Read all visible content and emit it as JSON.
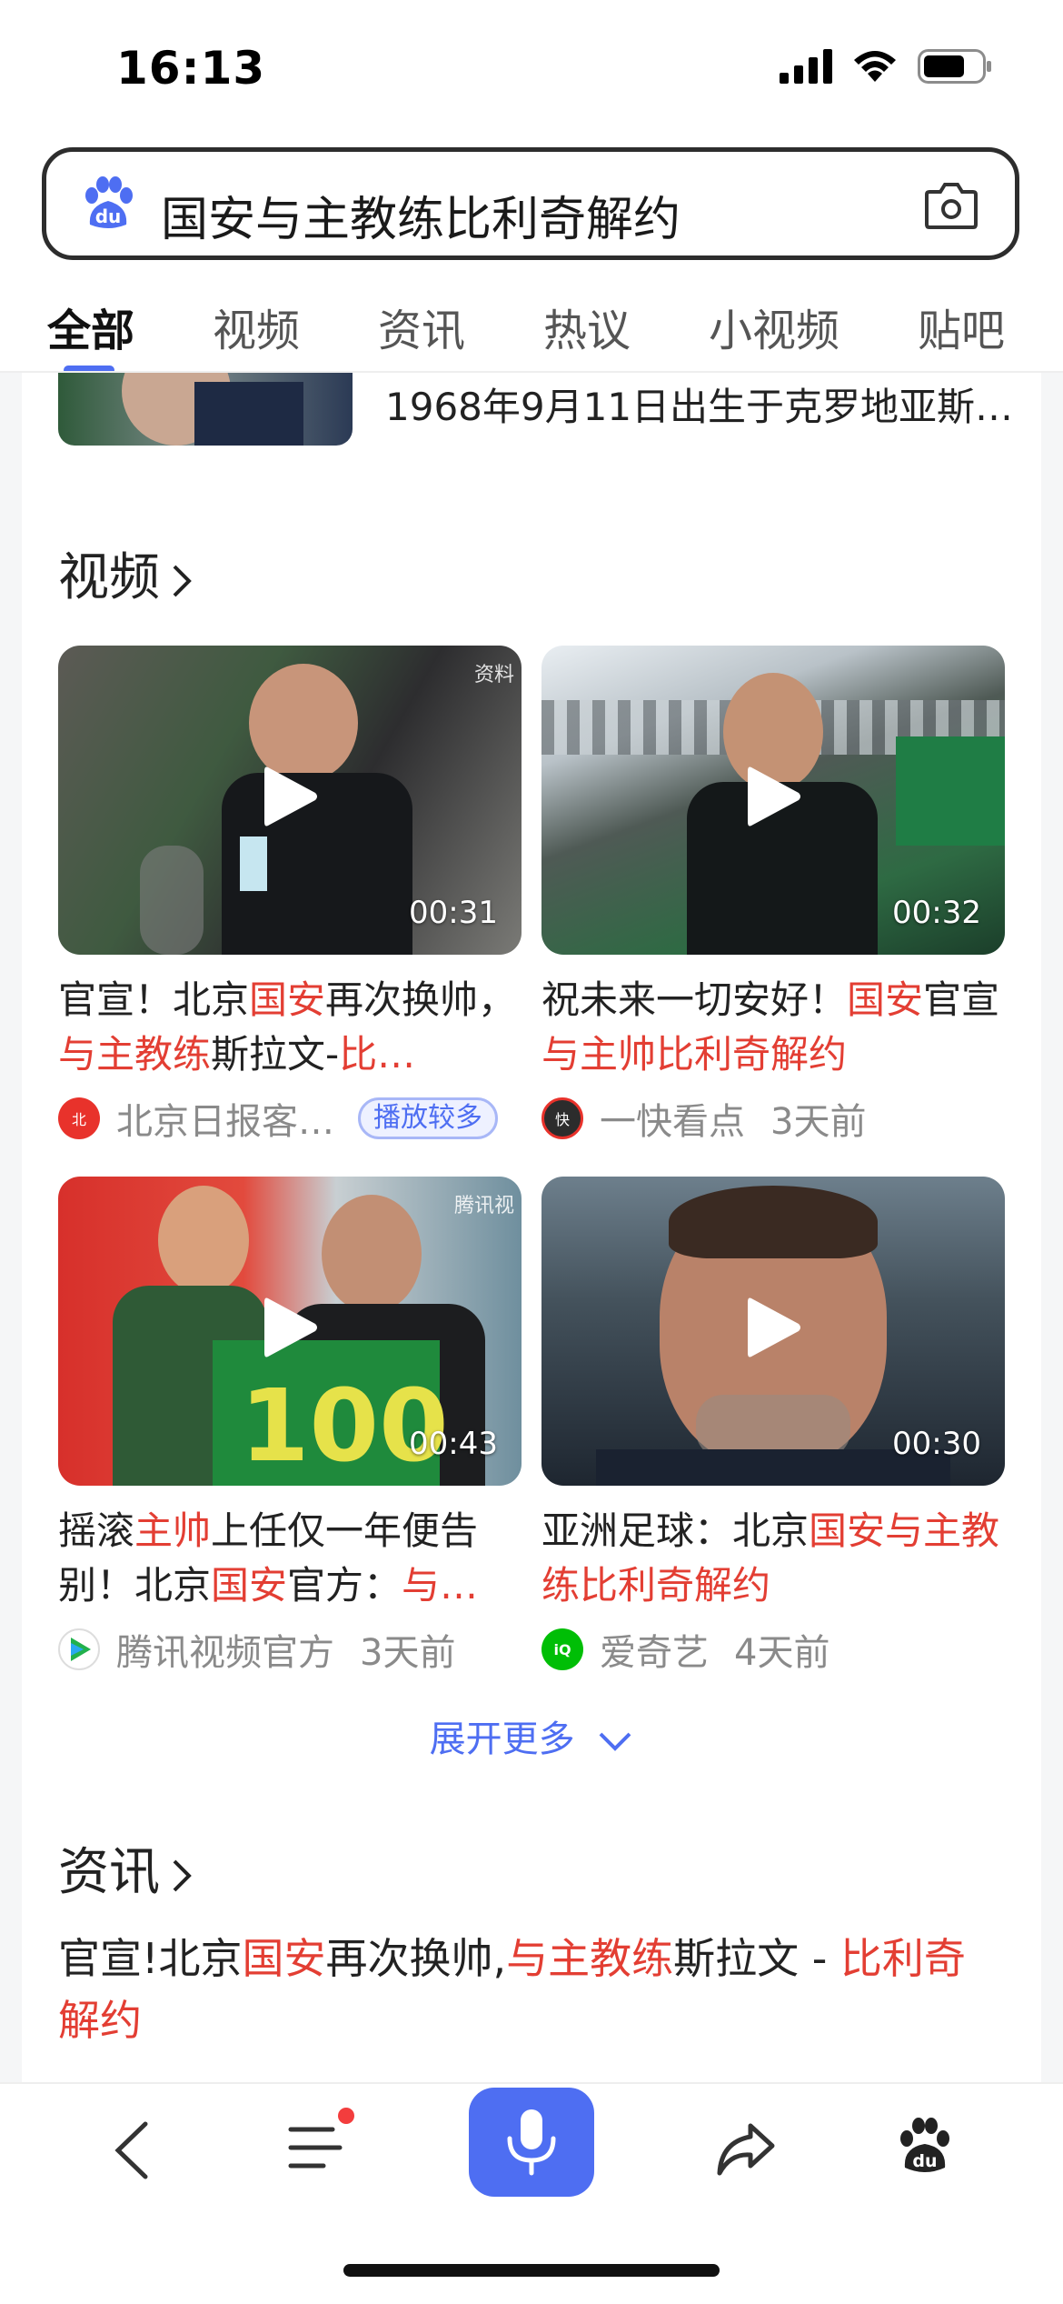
{
  "status_bar": {
    "time": "16:13"
  },
  "search": {
    "query": "国安与主教练比利奇解约"
  },
  "tabs": [
    {
      "label": "全部"
    },
    {
      "label": "视频"
    },
    {
      "label": "资讯"
    },
    {
      "label": "热议"
    },
    {
      "label": "小视频"
    },
    {
      "label": "贴吧"
    }
  ],
  "previous_result": {
    "description": "1968年9月11日出生于克罗地亚斯…"
  },
  "video_section": {
    "title": "视频",
    "videos": [
      {
        "duration": "00:31",
        "watermark": "资料",
        "title_parts": [
          {
            "text": "官宣！北京",
            "hl": false
          },
          {
            "text": "国安",
            "hl": true
          },
          {
            "text": "再次换帅，",
            "hl": false
          },
          {
            "text": "与主教练",
            "hl": true
          },
          {
            "text": "斯拉文-",
            "hl": false
          },
          {
            "text": "比…",
            "hl": true
          }
        ],
        "source": "北京日报客…",
        "badge": "播放较多",
        "time": ""
      },
      {
        "duration": "00:32",
        "watermark": "",
        "title_parts": [
          {
            "text": "祝未来一切安好！",
            "hl": false
          },
          {
            "text": "国安",
            "hl": true
          },
          {
            "text": "官宣",
            "hl": false
          },
          {
            "text": "与主帅比利奇解约",
            "hl": true
          }
        ],
        "source": "一快看点",
        "badge": "",
        "time": "3天前"
      },
      {
        "duration": "00:43",
        "watermark": "腾讯视",
        "title_parts": [
          {
            "text": "摇滚",
            "hl": false
          },
          {
            "text": "主帅",
            "hl": true
          },
          {
            "text": "上任仅一年便告别！北京",
            "hl": false
          },
          {
            "text": "国安",
            "hl": true
          },
          {
            "text": "官方：",
            "hl": false
          },
          {
            "text": "与…",
            "hl": true
          }
        ],
        "source": "腾讯视频官方",
        "badge": "",
        "time": "3天前"
      },
      {
        "duration": "00:30",
        "watermark": "",
        "title_parts": [
          {
            "text": "亚洲足球：北京",
            "hl": false
          },
          {
            "text": "国安与主教练比利奇解约",
            "hl": true
          }
        ],
        "source": "爱奇艺",
        "badge": "",
        "time": "4天前"
      }
    ],
    "expand_label": "展开更多"
  },
  "news_section": {
    "title": "资讯",
    "first_item_parts": [
      {
        "text": "官宣!北京",
        "hl": false
      },
      {
        "text": "国安",
        "hl": true
      },
      {
        "text": "再次换帅,",
        "hl": false
      },
      {
        "text": "与主教练",
        "hl": true
      },
      {
        "text": "斯拉文 - ",
        "hl": false
      },
      {
        "text": "比利奇解约",
        "hl": true
      }
    ]
  },
  "colors": {
    "accent": "#4e6ef2",
    "highlight": "#e33e33"
  },
  "bottom_nav": {
    "icons": [
      "back-icon",
      "menu-icon",
      "microphone-icon",
      "share-icon",
      "baidu-paw-icon"
    ]
  }
}
